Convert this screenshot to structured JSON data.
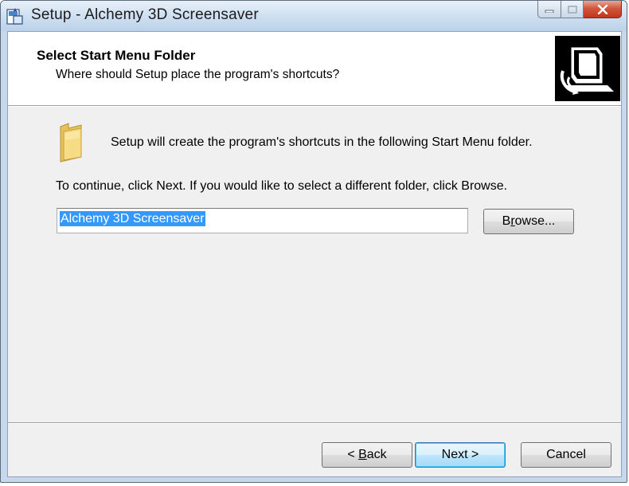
{
  "window": {
    "title": "Setup - Alchemy 3D Screensaver"
  },
  "title_bar_buttons": {
    "minimize_icon": "minimize-icon",
    "maximize_icon": "maximize-icon",
    "close_icon": "close-icon"
  },
  "header": {
    "title": "Select Start Menu Folder",
    "subtitle": "Where should Setup place the program's shortcuts?",
    "image_icon": "setup-computer-icon"
  },
  "body": {
    "folder_icon": "folder-icon",
    "intro": "Setup will create the program's shortcuts in the following Start Menu folder.",
    "continue_text": "To continue, click Next. If you would like to select a different folder, click Browse.",
    "folder_value": "Alchemy 3D Screensaver",
    "browse": {
      "pre": "B",
      "accel": "r",
      "post": "owse..."
    }
  },
  "footer": {
    "back": {
      "pre": "< ",
      "accel": "B",
      "post": "ack"
    },
    "next": "Next >",
    "cancel": "Cancel"
  },
  "colors": {
    "selection": "#3399ff",
    "close_button": "#c1361b",
    "default_button_border": "#3c7fb1"
  }
}
